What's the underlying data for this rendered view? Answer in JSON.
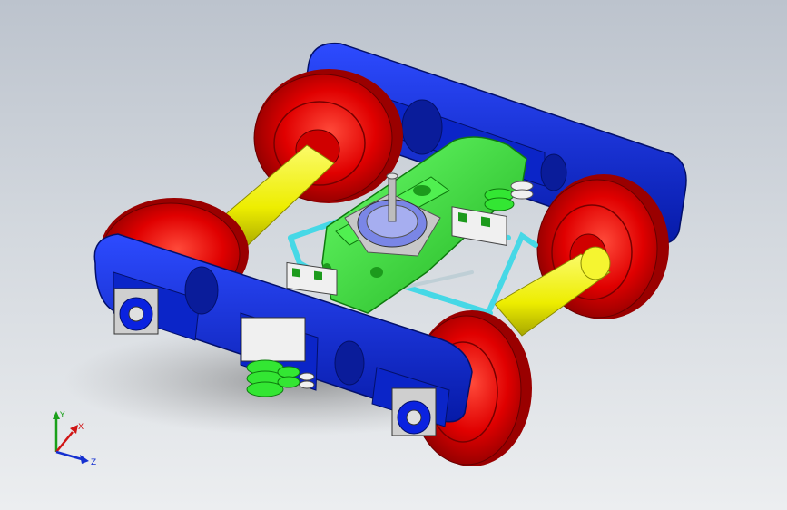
{
  "triad": {
    "y_label": "Y",
    "x_label": "X",
    "z_label": "Z",
    "y_color": "#1aa01a",
    "x_color": "#d01515",
    "z_color": "#1530d0"
  },
  "model": {
    "frame_color": "#0a22e0",
    "wheel_color": "#e00000",
    "axle_color": "#f0f000",
    "bolster_color": "#33e633",
    "brake_rod_color": "#46d8e6",
    "plate_color": "#7a86e6"
  }
}
